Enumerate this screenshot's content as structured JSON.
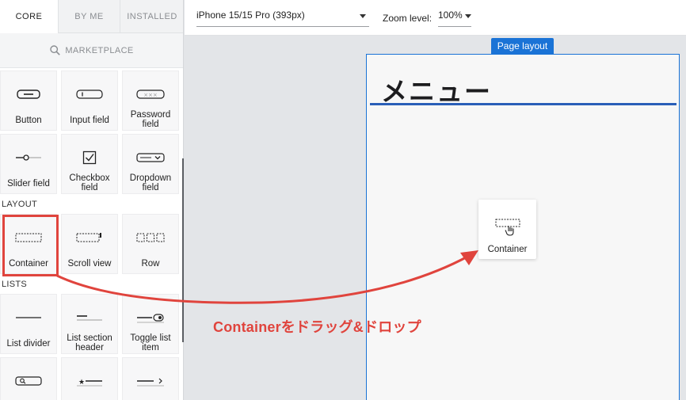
{
  "tabs": [
    {
      "label": "CORE",
      "active": true
    },
    {
      "label": "BY ME",
      "active": false
    },
    {
      "label": "INSTALLED",
      "active": false
    }
  ],
  "marketplace": {
    "label": "MARKETPLACE",
    "icon": "search-icon"
  },
  "tiles": {
    "button": "Button",
    "input_field": "Input field",
    "password_field_1": "Password",
    "password_field_2": "field",
    "slider_field": "Slider field",
    "checkbox_field_1": "Checkbox",
    "checkbox_field_2": "field",
    "dropdown_field_1": "Dropdown",
    "dropdown_field_2": "field",
    "container": "Container",
    "scroll_view": "Scroll view",
    "row": "Row",
    "list_divider": "List divider",
    "list_section_header_1": "List section",
    "list_section_header_2": "header",
    "toggle_list_item_1": "Toggle list",
    "toggle_list_item_2": "item"
  },
  "sections": {
    "layout": "LAYOUT",
    "lists": "LISTS"
  },
  "topbar": {
    "device": "iPhone 15/15 Pro (393px)",
    "zoom_label": "Zoom level:",
    "zoom_value": "100%"
  },
  "canvas": {
    "page_badge": "Page layout",
    "title": "メニュー",
    "drag_card_label": "Container"
  },
  "annotation": "Containerをドラッグ&ドロップ",
  "colors": {
    "accent": "#1a73d6",
    "highlight": "#e0443d"
  }
}
